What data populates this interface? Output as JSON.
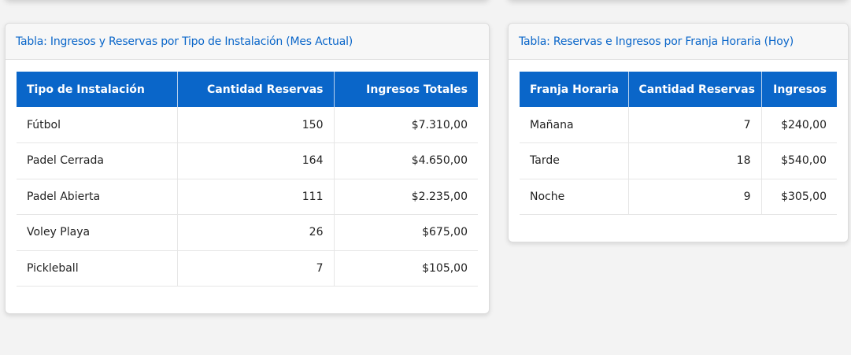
{
  "left_card": {
    "title": "Tabla: Ingresos y Reservas por Tipo de Instalación (Mes Actual)",
    "columns": [
      "Tipo de Instalación",
      "Cantidad Reservas",
      "Ingresos Totales"
    ],
    "rows": [
      [
        "Fútbol",
        "150",
        "$7.310,00"
      ],
      [
        "Padel Cerrada",
        "164",
        "$4.650,00"
      ],
      [
        "Padel Abierta",
        "111",
        "$2.235,00"
      ],
      [
        "Voley Playa",
        "26",
        "$675,00"
      ],
      [
        "Pickleball",
        "7",
        "$105,00"
      ]
    ]
  },
  "right_card": {
    "title": "Tabla: Reservas e Ingresos por Franja Horaria (Hoy)",
    "columns": [
      "Franja Horaria",
      "Cantidad Reservas",
      "Ingresos"
    ],
    "rows": [
      [
        "Mañana",
        "7",
        "$240,00"
      ],
      [
        "Tarde",
        "18",
        "$540,00"
      ],
      [
        "Noche",
        "9",
        "$305,00"
      ]
    ]
  },
  "colors": {
    "accent": "#0a66c9",
    "background": "#f3f3f3"
  }
}
